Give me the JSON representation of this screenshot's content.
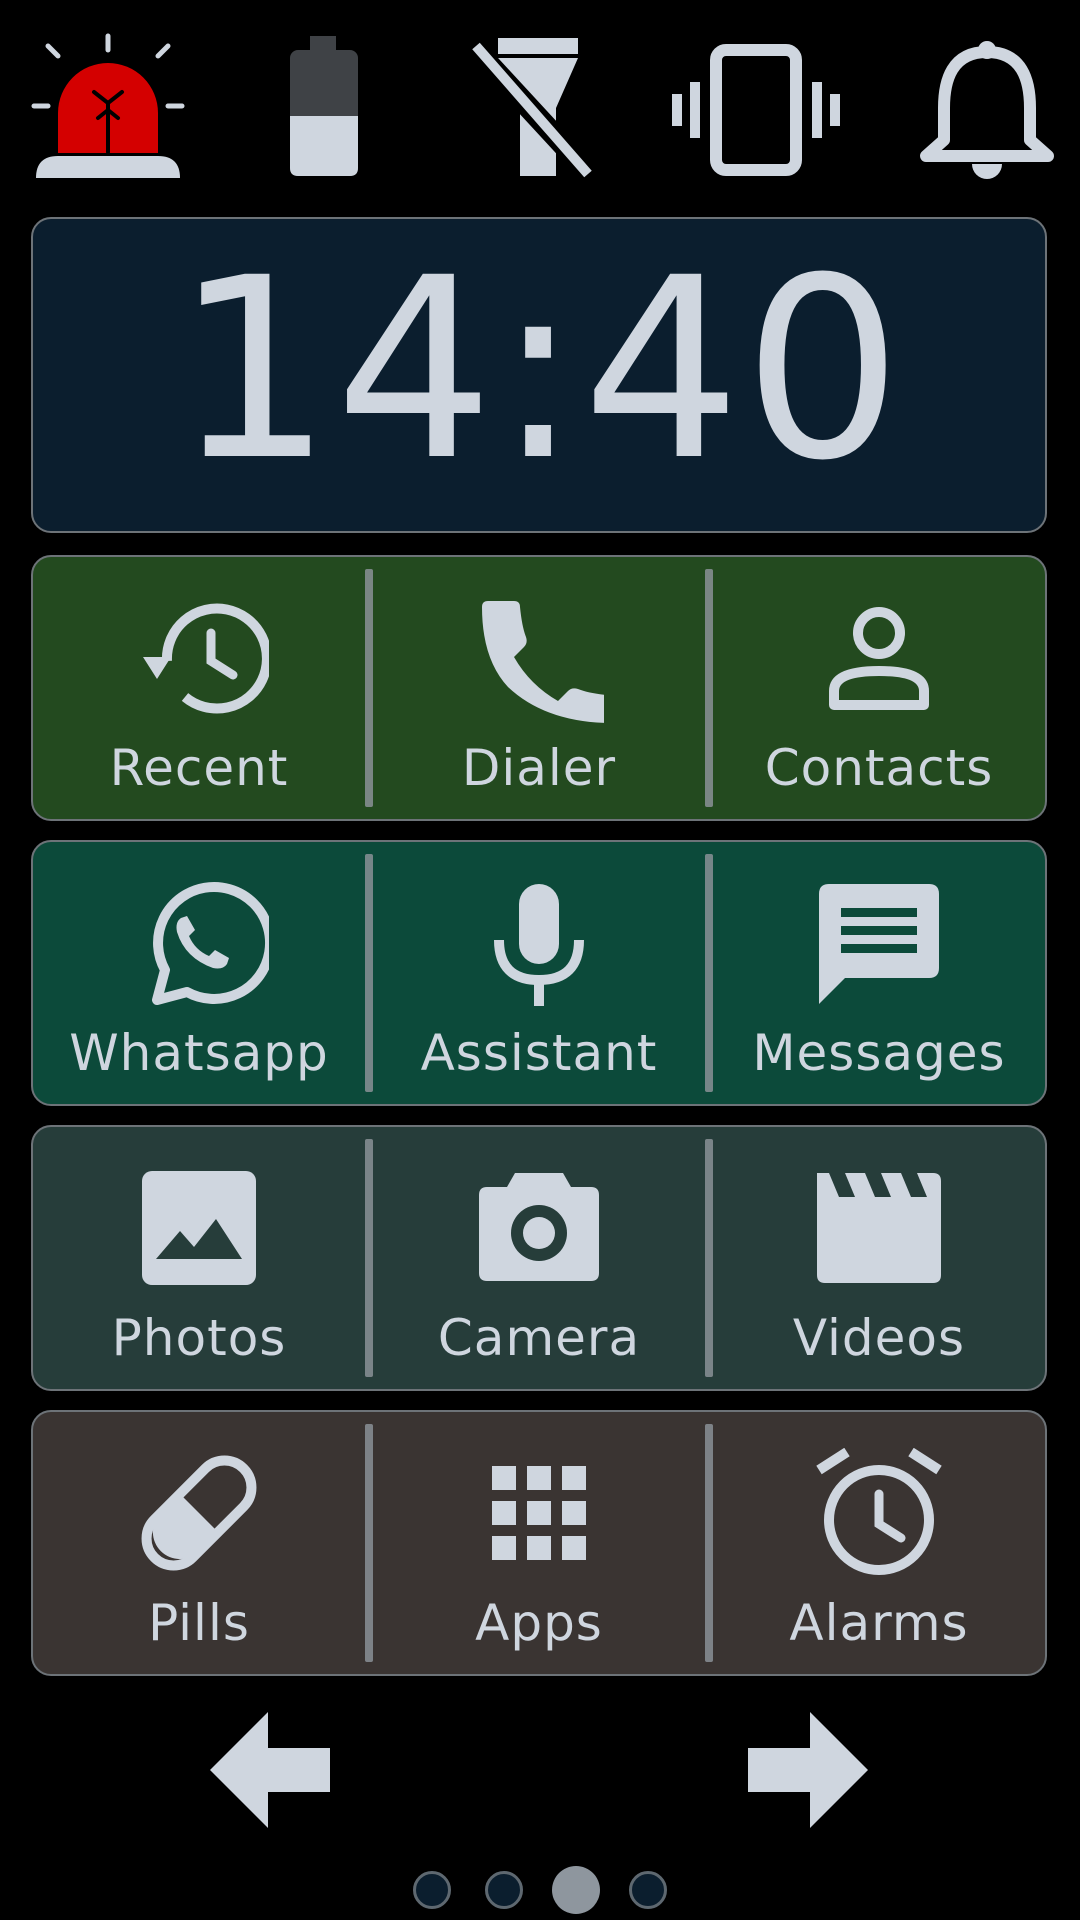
{
  "status_icons": [
    "emergency-siren-icon",
    "battery-icon",
    "flashlight-off-icon",
    "vibrate-icon",
    "bell-icon"
  ],
  "clock": {
    "time": "14:40"
  },
  "rows": [
    {
      "color": "#234a1f",
      "items": [
        {
          "label": "Recent",
          "icon": "history-icon"
        },
        {
          "label": "Dialer",
          "icon": "phone-icon"
        },
        {
          "label": "Contacts",
          "icon": "person-icon"
        }
      ]
    },
    {
      "color": "#0c4a3a",
      "items": [
        {
          "label": "Whatsapp",
          "icon": "whatsapp-icon"
        },
        {
          "label": "Assistant",
          "icon": "microphone-icon"
        },
        {
          "label": "Messages",
          "icon": "message-icon"
        }
      ]
    },
    {
      "color": "#263d3a",
      "items": [
        {
          "label": "Photos",
          "icon": "image-icon"
        },
        {
          "label": "Camera",
          "icon": "camera-icon"
        },
        {
          "label": "Videos",
          "icon": "clapperboard-icon"
        }
      ]
    },
    {
      "color": "#3a3432",
      "items": [
        {
          "label": "Pills",
          "icon": "pill-icon"
        },
        {
          "label": "Apps",
          "icon": "grid-icon"
        },
        {
          "label": "Alarms",
          "icon": "alarm-clock-icon"
        }
      ]
    }
  ],
  "pager": {
    "pages": 4,
    "current": 3
  },
  "colors": {
    "icon": "#cfd6df",
    "siren": "#d40000",
    "background": "#000000"
  }
}
